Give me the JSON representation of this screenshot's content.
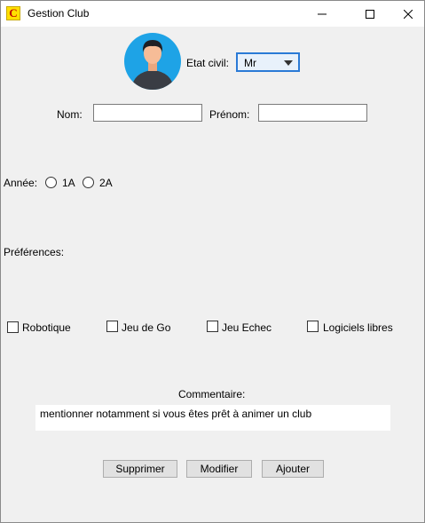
{
  "window": {
    "title": "Gestion Club",
    "app_icon_letter": "C"
  },
  "form": {
    "etat_civil_label": "Etat civil:",
    "etat_civil_value": "Mr",
    "nom_label": "Nom:",
    "nom_value": "",
    "prenom_label": "Prénom:",
    "prenom_value": "",
    "annee_label": "Année:",
    "annee_options": [
      "1A",
      "2A"
    ],
    "preferences_label": "Préférences:",
    "preferences": [
      "Robotique",
      "Jeu de Go",
      "Jeu Echec",
      "Logiciels libres"
    ],
    "commentaire_label": "Commentaire:",
    "commentaire_value": "mentionner notamment si vous êtes prêt à animer un club"
  },
  "buttons": {
    "supprimer": "Supprimer",
    "modifier": "Modifier",
    "ajouter": "Ajouter"
  },
  "icons": {
    "app": "app-c-icon",
    "minimize": "minimize-icon",
    "maximize": "maximize-icon",
    "close": "close-icon",
    "avatar": "user-avatar-icon",
    "dropdown": "chevron-down-icon"
  },
  "colors": {
    "avatar_bg": "#1ea3e6",
    "combo_focus": "#2a7ad6",
    "window_bg": "#f0f0f0"
  }
}
